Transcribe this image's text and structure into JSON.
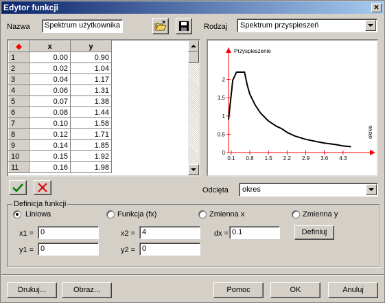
{
  "window": {
    "title": "Edytor funkcji",
    "close_glyph": "✕"
  },
  "top": {
    "name_label": "Nazwa",
    "name_value": "Spektrum użytkownika",
    "kind_label": "Rodzaj",
    "kind_value": "Spektrum przyspieszeń"
  },
  "table": {
    "headers": [
      "x",
      "y"
    ],
    "rows": [
      [
        "1",
        "0.00",
        "0.90"
      ],
      [
        "2",
        "0.02",
        "1.04"
      ],
      [
        "3",
        "0.04",
        "1.17"
      ],
      [
        "4",
        "0.06",
        "1.31"
      ],
      [
        "5",
        "0.07",
        "1.38"
      ],
      [
        "6",
        "0.08",
        "1.44"
      ],
      [
        "7",
        "0.10",
        "1.58"
      ],
      [
        "8",
        "0.12",
        "1.71"
      ],
      [
        "9",
        "0.14",
        "1.85"
      ],
      [
        "10",
        "0.15",
        "1.92"
      ],
      [
        "11",
        "0.16",
        "1.98"
      ]
    ]
  },
  "chart_data": {
    "type": "line",
    "title": "",
    "ylabel": "Przyspieszenie",
    "xlabel": "okres",
    "xlim": [
      0,
      5.0
    ],
    "ylim": [
      0,
      2.5
    ],
    "x_ticks": [
      "0.1",
      "0.8",
      "1.5",
      "2.2",
      "2.9",
      "3.6",
      "4.3"
    ],
    "x_tick_values": [
      0.1,
      0.8,
      1.5,
      2.2,
      2.9,
      3.6,
      4.3
    ],
    "y_ticks": [
      "0",
      "0.5",
      "1",
      "1.5",
      "2"
    ],
    "y_tick_values": [
      0,
      0.5,
      1,
      1.5,
      2
    ],
    "series": [
      {
        "x": [
          0,
          0.02,
          0.04,
          0.06,
          0.08,
          0.1,
          0.12,
          0.14,
          0.16,
          0.3,
          0.5,
          0.6,
          0.7,
          0.8,
          1.0,
          1.2,
          1.5,
          1.8,
          2.0,
          2.2,
          2.5,
          2.9,
          3.3,
          3.6,
          4.0,
          4.3,
          4.6
        ],
        "y": [
          0.9,
          1.04,
          1.17,
          1.31,
          1.44,
          1.58,
          1.71,
          1.85,
          1.98,
          2.2,
          2.2,
          2.2,
          1.85,
          1.6,
          1.3,
          1.08,
          0.86,
          0.72,
          0.65,
          0.55,
          0.45,
          0.36,
          0.3,
          0.26,
          0.22,
          0.18,
          0.16
        ]
      }
    ],
    "line_color": "#000000",
    "axis_color": "#ff0000"
  },
  "abscissa": {
    "label": "Odcięta",
    "value": "okres"
  },
  "definition": {
    "group_title": "Definicja funkcji",
    "radios": [
      "Liniowa",
      "Funkcja  (fx)",
      "Zmienna x",
      "Zmienna y"
    ],
    "x1_label": "x1 =",
    "x1_value": "0",
    "y1_label": "y1 =",
    "y1_value": "0",
    "x2_label": "x2 =",
    "x2_value": "4",
    "y2_label": "y2 =",
    "y2_value": "0",
    "dx_label": "dx =",
    "dx_value": "0.1",
    "define_button": "Definiuj"
  },
  "buttons": {
    "print": "Drukuj...",
    "image": "Obraz...",
    "help": "Pomoc",
    "ok": "OK",
    "cancel": "Anuluj"
  },
  "colors": {
    "accent_check": "#008000",
    "accent_x": "#e00000",
    "title_bg": "#0a246a"
  }
}
